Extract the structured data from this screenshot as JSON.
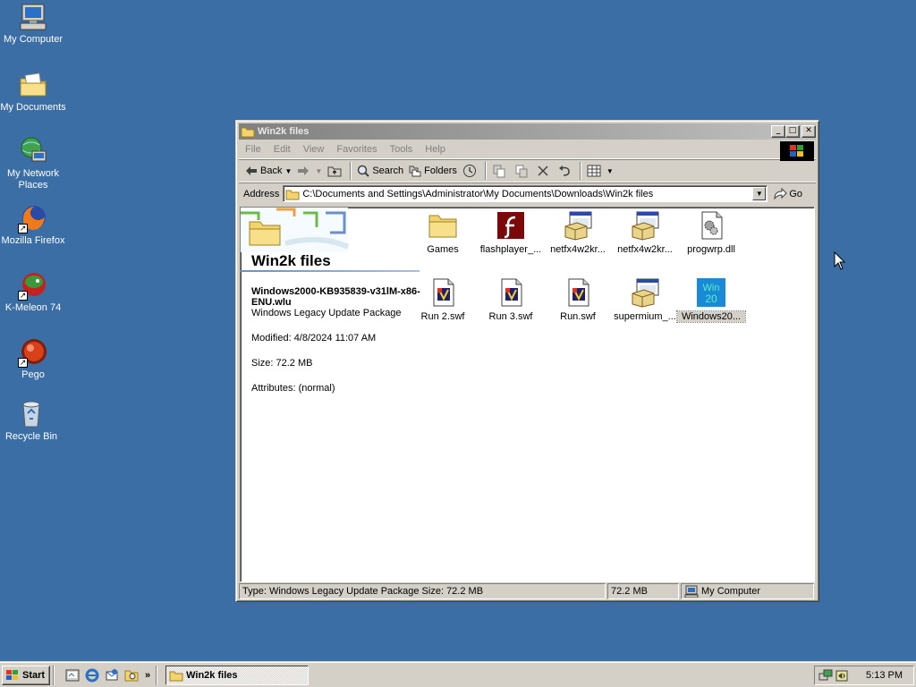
{
  "desktop": {
    "icons": [
      {
        "label": "My Computer"
      },
      {
        "label": "My Documents"
      },
      {
        "label": "My Network Places"
      },
      {
        "label": "Mozilla Firefox"
      },
      {
        "label": "K-Meleon 74"
      },
      {
        "label": "Pego"
      },
      {
        "label": "Recycle Bin"
      }
    ]
  },
  "window": {
    "title": "Win2k files",
    "menu": [
      "File",
      "Edit",
      "View",
      "Favorites",
      "Tools",
      "Help"
    ],
    "toolbar": {
      "back": "Back",
      "search": "Search",
      "folders": "Folders"
    },
    "address": {
      "label": "Address",
      "path": "C:\\Documents and Settings\\Administrator\\My Documents\\Downloads\\Win2k files",
      "go": "Go"
    },
    "left_pane": {
      "folder_title": "Win2k files",
      "selected_name": "Windows2000-KB935839-v31lM-x86-ENU.wlu",
      "selected_type": "Windows Legacy Update Package",
      "modified": "Modified: 4/8/2024 11:07 AM",
      "size": "Size: 72.2 MB",
      "attributes": "Attributes: (normal)"
    },
    "files": [
      {
        "label": "Games"
      },
      {
        "label": "flashplayer_..."
      },
      {
        "label": "netfx4w2kr..."
      },
      {
        "label": "netfx4w2kr..."
      },
      {
        "label": "progwrp.dll"
      },
      {
        "label": "Run 2.swf"
      },
      {
        "label": "Run 3.swf"
      },
      {
        "label": "Run.swf"
      },
      {
        "label": "supermium_..."
      },
      {
        "label": "Windows20..."
      }
    ],
    "status": {
      "main": "Type: Windows Legacy Update Package Size: 72.2 MB",
      "size": "72.2 MB",
      "zone": "My Computer"
    }
  },
  "taskbar": {
    "start": "Start",
    "task": "Win2k files",
    "clock": "5:13 PM"
  }
}
